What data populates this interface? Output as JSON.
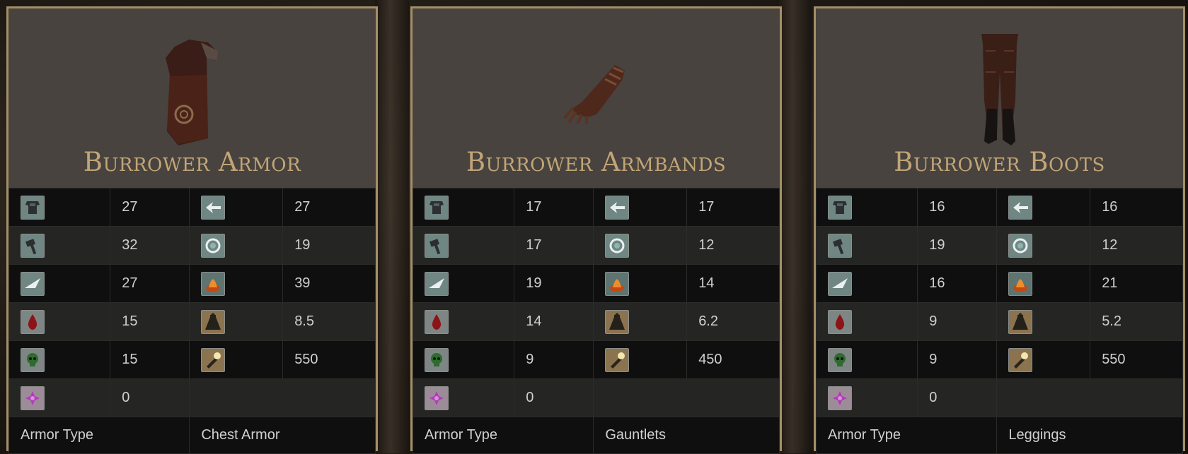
{
  "colors": {
    "accent": "#c2a577",
    "frame": "#a48f66",
    "panel": "#48433e"
  },
  "cards": [
    {
      "title": "Burrower Armor",
      "image_icon": "chest-armor-icon",
      "stats": [
        {
          "left_icon": "physical-defense-icon",
          "left_value": "27",
          "right_icon": "strike-defense-icon",
          "right_value": "27"
        },
        {
          "left_icon": "slash-defense-icon",
          "left_value": "32",
          "right_icon": "magic-defense-icon",
          "right_value": "19"
        },
        {
          "left_icon": "pierce-defense-icon",
          "left_value": "27",
          "right_icon": "fire-defense-icon",
          "right_value": "39"
        },
        {
          "left_icon": "bleed-resistance-icon",
          "left_value": "15",
          "right_icon": "weight-icon",
          "right_value": "8.5"
        },
        {
          "left_icon": "poison-resistance-icon",
          "left_value": "15",
          "right_icon": "durability-icon",
          "right_value": "550"
        },
        {
          "left_icon": "curse-resistance-icon",
          "left_value": "0"
        }
      ],
      "type_label": "Armor Type",
      "type_value": "Chest Armor"
    },
    {
      "title": "Burrower Armbands",
      "image_icon": "gauntlets-icon",
      "stats": [
        {
          "left_icon": "physical-defense-icon",
          "left_value": "17",
          "right_icon": "strike-defense-icon",
          "right_value": "17"
        },
        {
          "left_icon": "slash-defense-icon",
          "left_value": "17",
          "right_icon": "magic-defense-icon",
          "right_value": "12"
        },
        {
          "left_icon": "pierce-defense-icon",
          "left_value": "19",
          "right_icon": "fire-defense-icon",
          "right_value": "14"
        },
        {
          "left_icon": "bleed-resistance-icon",
          "left_value": "14",
          "right_icon": "weight-icon",
          "right_value": "6.2"
        },
        {
          "left_icon": "poison-resistance-icon",
          "left_value": "9",
          "right_icon": "durability-icon",
          "right_value": "450"
        },
        {
          "left_icon": "curse-resistance-icon",
          "left_value": "0"
        }
      ],
      "type_label": "Armor Type",
      "type_value": "Gauntlets"
    },
    {
      "title": "Burrower Boots",
      "image_icon": "leggings-icon",
      "stats": [
        {
          "left_icon": "physical-defense-icon",
          "left_value": "16",
          "right_icon": "strike-defense-icon",
          "right_value": "16"
        },
        {
          "left_icon": "slash-defense-icon",
          "left_value": "19",
          "right_icon": "magic-defense-icon",
          "right_value": "12"
        },
        {
          "left_icon": "pierce-defense-icon",
          "left_value": "16",
          "right_icon": "fire-defense-icon",
          "right_value": "21"
        },
        {
          "left_icon": "bleed-resistance-icon",
          "left_value": "9",
          "right_icon": "weight-icon",
          "right_value": "5.2"
        },
        {
          "left_icon": "poison-resistance-icon",
          "left_value": "9",
          "right_icon": "durability-icon",
          "right_value": "550"
        },
        {
          "left_icon": "curse-resistance-icon",
          "left_value": "0"
        }
      ],
      "type_label": "Armor Type",
      "type_value": "Leggings"
    }
  ]
}
